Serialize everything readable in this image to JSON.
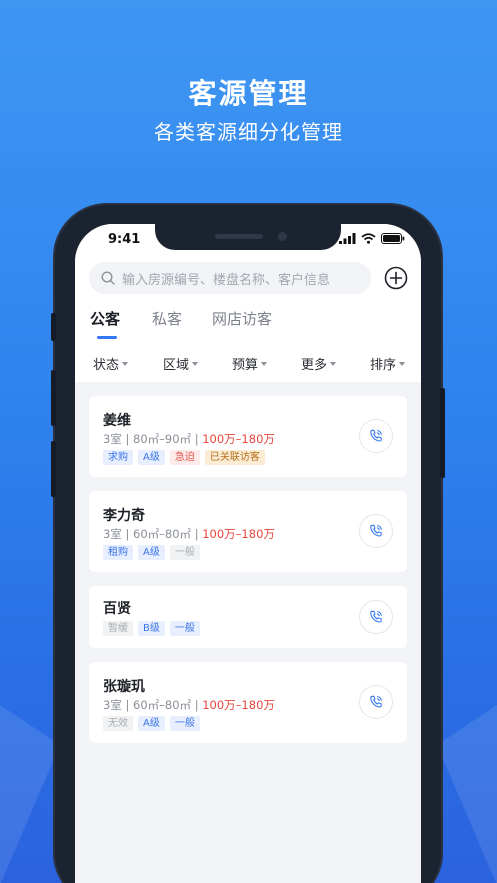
{
  "banner": {
    "title": "客源管理",
    "subtitle": "各类客源细分化管理"
  },
  "status_bar": {
    "time": "9:41"
  },
  "search": {
    "placeholder": "输入房源编号、楼盘名称、客户信息"
  },
  "tabs": [
    {
      "label": "公客",
      "active": true
    },
    {
      "label": "私客",
      "active": false
    },
    {
      "label": "网店访客",
      "active": false
    }
  ],
  "filters": [
    "状态",
    "区域",
    "预算",
    "更多",
    "排序"
  ],
  "customers": [
    {
      "name": "姜维",
      "rooms": "3室",
      "area": "80㎡–90㎡",
      "price": "100万–180万",
      "tags": [
        {
          "label": "求购",
          "style": "blue"
        },
        {
          "label": "A级",
          "style": "blue"
        },
        {
          "label": "急迫",
          "style": "red"
        },
        {
          "label": "已关联访客",
          "style": "orange"
        }
      ]
    },
    {
      "name": "李力奇",
      "rooms": "3室",
      "area": "60㎡–80㎡",
      "price": "100万–180万",
      "tags": [
        {
          "label": "租购",
          "style": "blue"
        },
        {
          "label": "A级",
          "style": "blue"
        },
        {
          "label": "一般",
          "style": "gray"
        }
      ]
    },
    {
      "name": "百贤",
      "tags": [
        {
          "label": "暂缓",
          "style": "gray"
        },
        {
          "label": "B级",
          "style": "blue"
        },
        {
          "label": "一般",
          "style": "blue"
        }
      ]
    },
    {
      "name": "张璇玑",
      "rooms": "3室",
      "area": "60㎡–80㎡",
      "price": "100万–180万",
      "tags": [
        {
          "label": "无效",
          "style": "gray"
        },
        {
          "label": "A级",
          "style": "blue"
        },
        {
          "label": "一般",
          "style": "blue"
        }
      ]
    }
  ],
  "colors": {
    "accent": "#3477f2",
    "price": "#e8453c",
    "background_top": "#3f97f2",
    "background_bottom": "#2b63de"
  },
  "icons": {
    "search": "search-icon",
    "add": "add-icon",
    "call": "phone-icon"
  }
}
